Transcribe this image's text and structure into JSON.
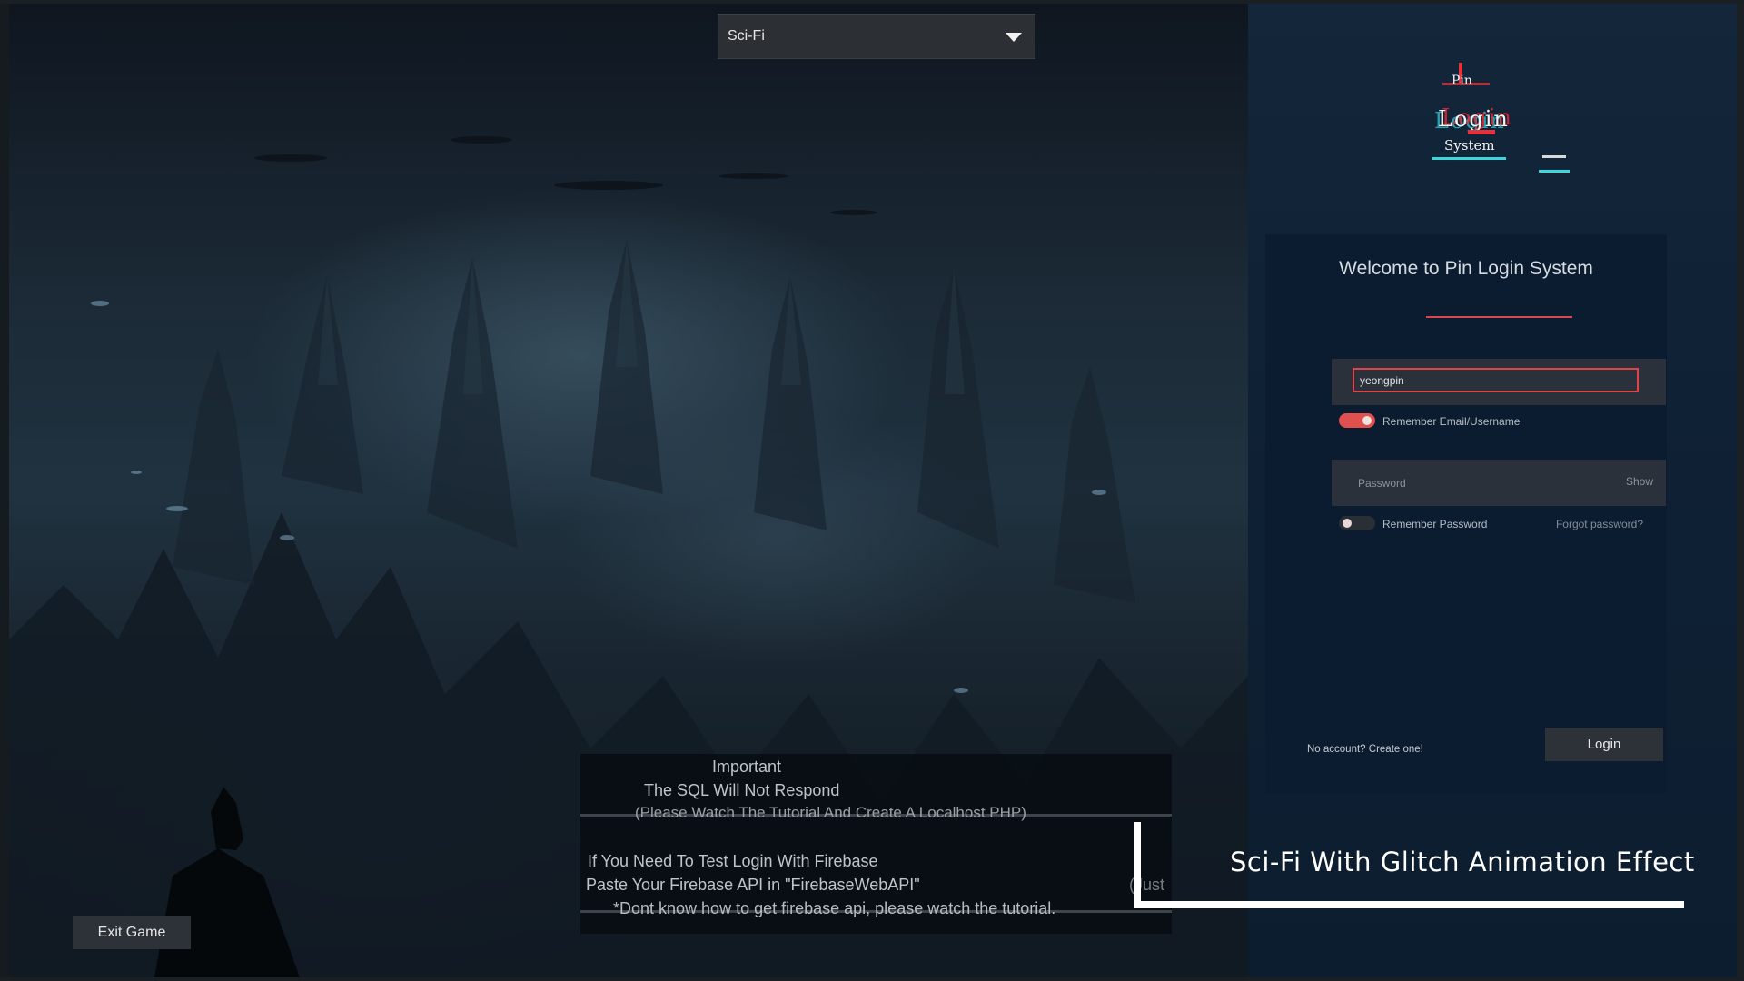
{
  "theme_selector": {
    "value": "Sci-Fi"
  },
  "logo": {
    "line1": "Pin",
    "line2": "Login",
    "line3": "System"
  },
  "login": {
    "welcome": "Welcome to Pin Login System",
    "username_value": "yeongpin",
    "remember_user_label": "Remember Email/Username",
    "remember_user_on": true,
    "password_placeholder": "Password",
    "show_label": "Show",
    "remember_password_label": "Remember Password",
    "remember_password_on": false,
    "forgot_label": "Forgot password?",
    "create_account_label": "No account? Create one!",
    "login_label": "Login"
  },
  "notice": {
    "title": "Important",
    "sql": "The SQL Will Not Respond",
    "tutorial": "(Please Watch The Tutorial And Create A Localhost PHP)",
    "firebase": "If You Need To Test Login With Firebase",
    "paste": "Paste Your Firebase API in \"FirebaseWebAPI\"",
    "paste_end": "(Just",
    "howto": "*Dont know how to get firebase api, please watch the tutorial."
  },
  "caption": "Sci-Fi With Glitch Animation Effect",
  "exit_label": "Exit Game",
  "colors": {
    "accent": "#e0434a",
    "panel": "#0b1c30",
    "button": "#2d3238"
  }
}
